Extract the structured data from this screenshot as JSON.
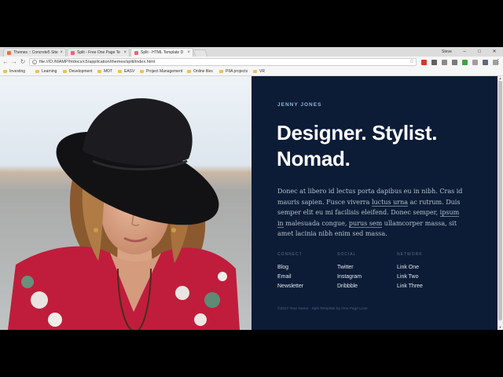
{
  "browser": {
    "tabs": [
      {
        "label": "Themes :: Concrete5 Site",
        "favicon_color": "#e5743b"
      },
      {
        "label": "Split - Free One Page Te",
        "favicon_color": "#e4697a"
      },
      {
        "label": "Split - HTML Template D",
        "favicon_color": "#e4697a"
      }
    ],
    "user": "Steve",
    "window_controls": {
      "minimize": "–",
      "maximize": "□",
      "close": "✕"
    },
    "tab_close": "×",
    "nav": {
      "back": "←",
      "forward": "→",
      "reload": "↻"
    },
    "info_icon": "i",
    "url": "file:///D:/MAMP/htdocs/c5/application/themes/split/index.html",
    "star": "☆",
    "menu": "⋮",
    "extension_colors": [
      "#d23a2c",
      "#616161",
      "#8a8a8a",
      "#7a7a7a",
      "#43a047",
      "#9e9e9e",
      "#5f6b7a",
      "#a0a0a0",
      "#9e9e9e"
    ],
    "bookmarks": [
      "Investing",
      "Learning",
      "Development",
      "MOT",
      "EASV",
      "Project Management",
      "Online files",
      "PIIA projects",
      "VR"
    ]
  },
  "page": {
    "eyebrow": "JENNY JONES",
    "headline_line1": "Designer. Stylist.",
    "headline_line2": "Nomad.",
    "bio": {
      "p1": "Donec at libero id lectus porta dapibus eu in nibh. Cras id mauris sapien. Fusce viverra ",
      "link1": "luctus urna",
      "p2": " ac rutrum. Duis semper elit eu mi facilisis eleifend. Donec semper, ",
      "link2": "ipsum in",
      "p3": " malesuada congue, ",
      "link3": "purus sem",
      "p4": " ullamcorper massa, sit amet lacinia nibh enim sed massa."
    },
    "columns": [
      {
        "heading": "CONNECT",
        "items": [
          "Blog",
          "Email",
          "Newsletter"
        ]
      },
      {
        "heading": "SOCIAL",
        "items": [
          "Twitter",
          "Instagram",
          "Dribbble"
        ]
      },
      {
        "heading": "NETWORK",
        "items": [
          "Link One",
          "Link Two",
          "Link Three"
        ]
      }
    ],
    "footer": "©2017 Your Name · Split Template by One Page Love",
    "scroll_up": "▲",
    "scroll_down": "▼"
  }
}
